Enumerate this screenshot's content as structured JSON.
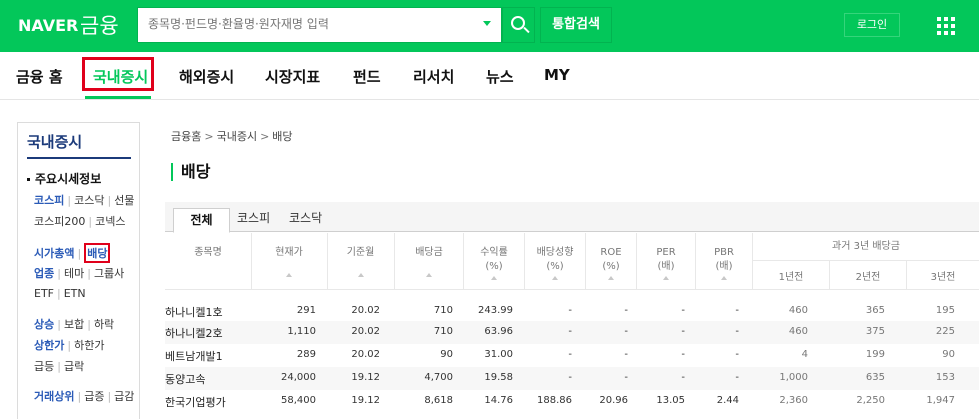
{
  "header": {
    "naver": "NAVER",
    "finance": "금융",
    "search_placeholder": "종목명·펀드명·환율명·원자재명 입력",
    "integrated_search": "통합검색",
    "login": "로그인"
  },
  "nav": {
    "items": [
      "금융 홈",
      "국내증시",
      "해외증시",
      "시장지표",
      "펀드",
      "리서치",
      "뉴스",
      "MY"
    ]
  },
  "sidebar": {
    "title": "국내증시",
    "section": "주요시세정보",
    "row1": [
      "코스피",
      "코스닥",
      "선물"
    ],
    "row2": [
      "코스피200",
      "코넥스"
    ],
    "row3": [
      "시가총액",
      "배당"
    ],
    "row4": [
      "업종",
      "테마",
      "그룹사"
    ],
    "row5": [
      "ETF",
      "ETN"
    ],
    "row6": [
      "상승",
      "보합",
      "하락"
    ],
    "row7": [
      "상한가",
      "하한가"
    ],
    "row8": [
      "급등",
      "급락"
    ],
    "row9": [
      "거래상위",
      "급증",
      "급감"
    ]
  },
  "breadcrumb": [
    "금융홈",
    "국내증시",
    "배당"
  ],
  "page_title": "배당",
  "tabs": [
    "전체",
    "코스피",
    "코스닥"
  ],
  "table": {
    "headers": {
      "name": "종목명",
      "price": "현재가",
      "base_month": "기준월",
      "dividend": "배당금",
      "yield_1": "수익률",
      "yield_2": "(%)",
      "payout_1": "배당성향",
      "payout_2": "(%)",
      "roe_1": "ROE",
      "roe_2": "(%)",
      "per_1": "PER",
      "per_2": "(배)",
      "pbr_1": "PBR",
      "pbr_2": "(배)",
      "past": "과거 3년 배당금",
      "y1": "1년전",
      "y2": "2년전",
      "y3": "3년전"
    },
    "rows": [
      {
        "name": "하나니켈1호",
        "price": "291",
        "month": "20.02",
        "div": "710",
        "yield": "243.99",
        "payout": "-",
        "roe": "-",
        "per": "-",
        "pbr": "-",
        "y1": "460",
        "y2": "365",
        "y3": "195"
      },
      {
        "name": "하나니켈2호",
        "price": "1,110",
        "month": "20.02",
        "div": "710",
        "yield": "63.96",
        "payout": "-",
        "roe": "-",
        "per": "-",
        "pbr": "-",
        "y1": "460",
        "y2": "375",
        "y3": "225"
      },
      {
        "name": "베트남개발1",
        "price": "289",
        "month": "20.02",
        "div": "90",
        "yield": "31.00",
        "payout": "-",
        "roe": "-",
        "per": "-",
        "pbr": "-",
        "y1": "4",
        "y2": "199",
        "y3": "90"
      },
      {
        "name": "동양고속",
        "price": "24,000",
        "month": "19.12",
        "div": "4,700",
        "yield": "19.58",
        "payout": "-",
        "roe": "-",
        "per": "-",
        "pbr": "-",
        "y1": "1,000",
        "y2": "635",
        "y3": "153"
      },
      {
        "name": "한국기업평가",
        "price": "58,400",
        "month": "19.12",
        "div": "8,618",
        "yield": "14.76",
        "payout": "188.86",
        "roe": "20.96",
        "per": "13.05",
        "pbr": "2.44",
        "y1": "2,360",
        "y2": "2,250",
        "y3": "1,947"
      }
    ]
  }
}
